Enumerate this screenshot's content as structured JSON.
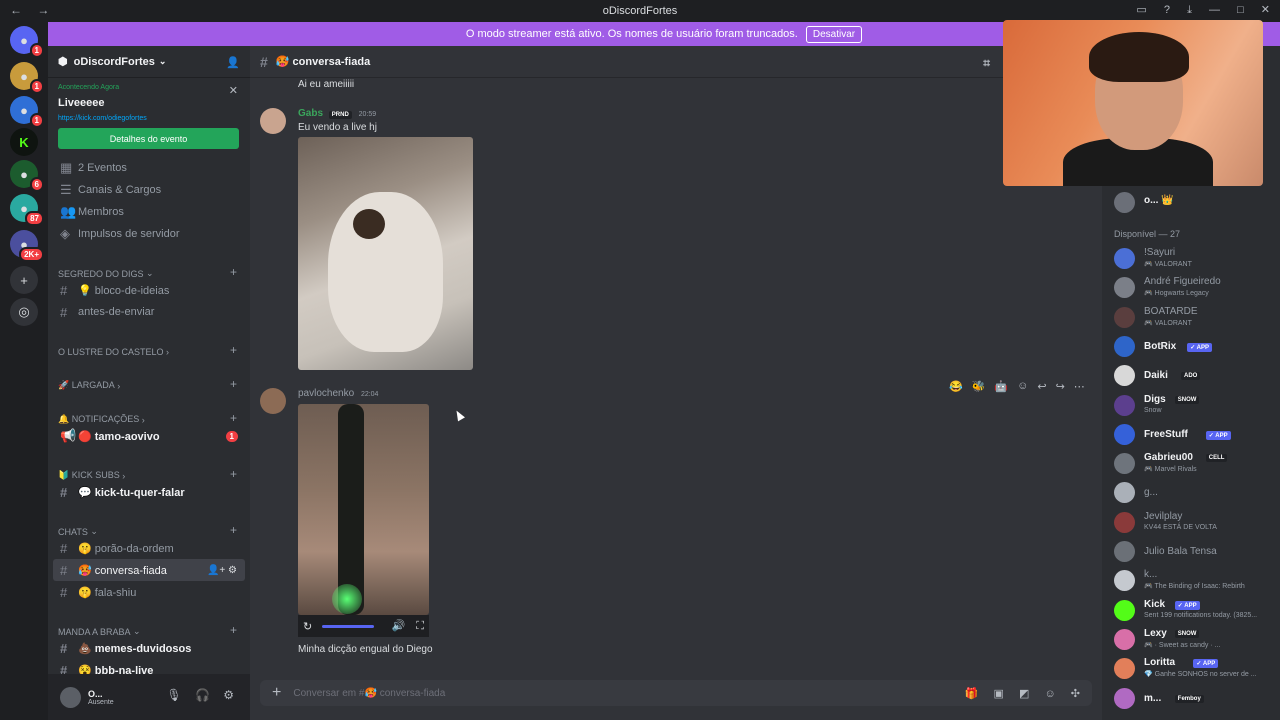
{
  "window": {
    "title": "oDiscordFortes",
    "back": "←",
    "forward": "→"
  },
  "banner": {
    "text": "O modo streamer está ativo. Os nomes de usuário foram truncados.",
    "button": "Desativar"
  },
  "servers": [
    {
      "label": "●",
      "badge": "1"
    },
    {
      "label": "●",
      "badge": "1"
    },
    {
      "label": "●",
      "badge": "1"
    },
    {
      "label": "K",
      "badge": ""
    },
    {
      "label": "●",
      "badge": "6"
    },
    {
      "label": "●",
      "badge": "87"
    },
    {
      "label": "●",
      "badge": "2K+"
    },
    {
      "label": "+",
      "badge": ""
    },
    {
      "label": "◎",
      "badge": ""
    }
  ],
  "guild": {
    "name": "oDiscordFortes"
  },
  "event": {
    "live": "Acontecendo Agora",
    "name": "Liveeeee",
    "link": "https://kick.com/odiegofortes",
    "button": "Detalhes do evento"
  },
  "nav_items": [
    "2 Eventos",
    "Canais & Cargos",
    "Membros",
    "Impulsos de servidor"
  ],
  "sections": {
    "segredo": "SEGREDO DO DIGS",
    "lustre": "O LUSTRE DO CASTELO",
    "largada": "🚀 LARGADA",
    "notificacoes": "🔔 NOTIFICAÇÕES",
    "kicksubs": "🔰 KICK SUBS",
    "chats": "CHATS",
    "mandabraba": "MANDA A BRABA"
  },
  "channels": {
    "bloco": "💡 bloco-de-ideias",
    "antes": "antes-de-enviar",
    "tamo": "🔴 tamo-aovivo",
    "tamo_badge": "1",
    "kick": "💬 kick-tu-quer-falar",
    "porao": "🤫 porão-da-ordem",
    "conversa": "🥵 conversa-fiada",
    "fala": "🤫 fala-shiu",
    "memes": "💩 memes-duvidosos",
    "bbb": "😵 bbb-na-live"
  },
  "user": {
    "name": "O...",
    "status": "Ausente"
  },
  "chat": {
    "channel": "🥵 conversa-fiada",
    "top_text": "Ai eu ameiiiii",
    "m1": {
      "author": "Gabs",
      "tag": "PRND",
      "time": "20:59",
      "text": "Eu vendo a live hj"
    },
    "m2": {
      "author": "pavlochenko",
      "time": "22:04",
      "text": "Minha dicção engual do Diego"
    },
    "composer": "Conversar em #🥵 conversa-fiada"
  },
  "members": {
    "top": "o... 👑",
    "group": "Disponível — 27",
    "list": [
      {
        "name": "!Sayuri",
        "status": "🎮 VALORANT",
        "tag": ""
      },
      {
        "name": "André Figueiredo",
        "status": "🎮 Hogwarts Legacy",
        "tag": ""
      },
      {
        "name": "BOATARDE",
        "status": "🎮 VALORANT",
        "tag": ""
      },
      {
        "name": "BotRix",
        "status": "",
        "tag": "✓ APP"
      },
      {
        "name": "Daiki",
        "status": "",
        "tag": "ADO"
      },
      {
        "name": "Digs",
        "status": "Snow",
        "tag": "SNOW"
      },
      {
        "name": "FreeStuff",
        "status": "",
        "tag": "✓ APP"
      },
      {
        "name": "Gabrieu00",
        "status": "🎮 Marvel Rivals",
        "tag": "CELL"
      },
      {
        "name": "g...",
        "status": "",
        "tag": ""
      },
      {
        "name": "Jevilplay",
        "status": "KV44 ESTÁ DE VOLTA",
        "tag": ""
      },
      {
        "name": "Julio Bala Tensa",
        "status": "",
        "tag": ""
      },
      {
        "name": "k...",
        "status": "🎮 The Binding of Isaac: Rebirth",
        "tag": ""
      },
      {
        "name": "Kick",
        "status": "Sent 199 notifications today. (3825...",
        "tag": "✓ APP"
      },
      {
        "name": "Lexy",
        "status": "🎮 · Sweet as candy · ...",
        "tag": "SNOW"
      },
      {
        "name": "Loritta",
        "status": "💎 Ganhe SONHOS no server de ...",
        "tag": "✓ APP"
      },
      {
        "name": "m...",
        "status": "",
        "tag": "Femboy"
      }
    ]
  },
  "colors": {
    "accent": "#5865f2",
    "green": "#23a55a",
    "banner": "#a05ce6",
    "red": "#f23f43"
  }
}
